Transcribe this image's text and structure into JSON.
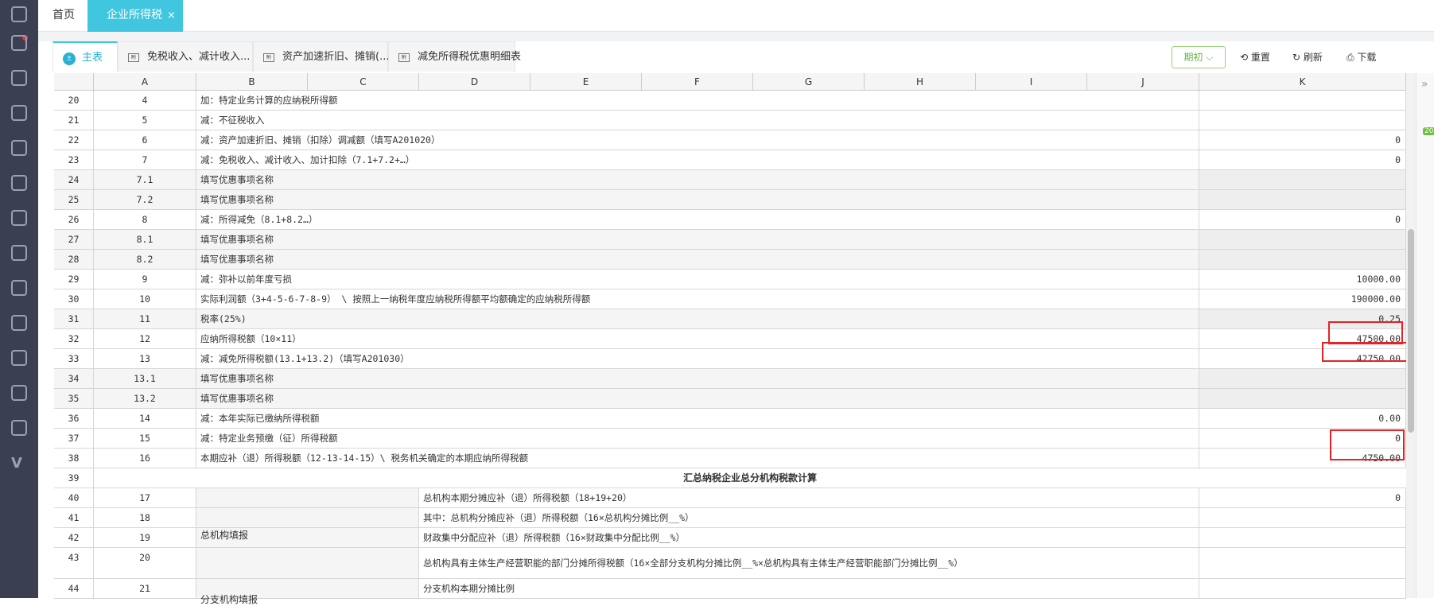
{
  "tabs": {
    "home": "首页",
    "active": "企业所得税",
    "close": "×"
  },
  "sheet_tabs": [
    {
      "label": "主表",
      "icon": "主"
    },
    {
      "label": "免税收入、减计收入...",
      "icon": "附"
    },
    {
      "label": "资产加速折旧、摊销(...",
      "icon": "附"
    },
    {
      "label": "减免所得税优惠明细表",
      "icon": "附"
    }
  ],
  "toolbar": {
    "period": "期初 ⌵",
    "reset": "重置",
    "refresh": "刷新",
    "download": "下载"
  },
  "columns": [
    "A",
    "B",
    "C",
    "D",
    "E",
    "F",
    "G",
    "H",
    "I",
    "J",
    "K"
  ],
  "rows": [
    {
      "n": "20",
      "idx": "4",
      "desc": "加：特定业务计算的应纳税所得额",
      "val": "",
      "shaded": false
    },
    {
      "n": "21",
      "idx": "5",
      "desc": "减：不征税收入",
      "val": "",
      "shaded": false
    },
    {
      "n": "22",
      "idx": "6",
      "desc": "减：资产加速折旧、摊销（扣除）调减额（填写A201020）",
      "val": "0",
      "shaded": false
    },
    {
      "n": "23",
      "idx": "7",
      "desc": "减：免税收入、减计收入、加计扣除（7.1+7.2+…）",
      "val": "0",
      "shaded": false
    },
    {
      "n": "24",
      "idx": "7.1",
      "desc": "填写优惠事项名称",
      "val": "",
      "shaded": true
    },
    {
      "n": "25",
      "idx": "7.2",
      "desc": "填写优惠事项名称",
      "val": "",
      "shaded": true
    },
    {
      "n": "26",
      "idx": "8",
      "desc": "减：所得减免（8.1+8.2…）",
      "val": "0",
      "shaded": false
    },
    {
      "n": "27",
      "idx": "8.1",
      "desc": "填写优惠事项名称",
      "val": "",
      "shaded": true
    },
    {
      "n": "28",
      "idx": "8.2",
      "desc": "填写优惠事项名称",
      "val": "",
      "shaded": true
    },
    {
      "n": "29",
      "idx": "9",
      "desc": "减：弥补以前年度亏损",
      "val": "10000.00",
      "shaded": false
    },
    {
      "n": "30",
      "idx": "10",
      "desc": "实际利润额（3+4-5-6-7-8-9） \\ 按照上一纳税年度应纳税所得额平均额确定的应纳税所得额",
      "val": "190000.00",
      "shaded": false
    },
    {
      "n": "31",
      "idx": "11",
      "desc": "税率(25%)",
      "val": "0.25",
      "shaded": true
    },
    {
      "n": "32",
      "idx": "12",
      "desc": "应纳所得税额（10×11）",
      "val": "47500.00",
      "shaded": false
    },
    {
      "n": "33",
      "idx": "13",
      "desc": "减：减免所得税额(13.1+13.2)（填写A201030）",
      "val": "42750.00",
      "shaded": false
    },
    {
      "n": "34",
      "idx": "13.1",
      "desc": "填写优惠事项名称",
      "val": "",
      "shaded": true
    },
    {
      "n": "35",
      "idx": "13.2",
      "desc": "填写优惠事项名称",
      "val": "",
      "shaded": true
    },
    {
      "n": "36",
      "idx": "14",
      "desc": "减：本年实际已缴纳所得税额",
      "val": "0.00",
      "shaded": false
    },
    {
      "n": "37",
      "idx": "15",
      "desc": "减：特定业务预缴（征）所得税额",
      "val": "0",
      "shaded": false
    },
    {
      "n": "38",
      "idx": "16",
      "desc": "本期应补（退）所得税额（12-13-14-15）\\ 税务机关确定的本期应纳所得税额",
      "val": "4750.00",
      "shaded": false
    }
  ],
  "section_row": {
    "n": "39",
    "title": "汇总纳税企业总分机构税款计算"
  },
  "lower_rows": [
    {
      "n": "40",
      "idx": "17",
      "desc": "总机构本期分摊应补（退）所得税额（18+19+20）",
      "val": "0"
    },
    {
      "n": "41",
      "idx": "18",
      "desc": "其中：总机构分摊应补（退）所得税额（16×总机构分摊比例__%）",
      "val": ""
    },
    {
      "n": "42",
      "idx": "19",
      "desc": "财政集中分配应补（退）所得税额（16×财政集中分配比例__%）",
      "val": ""
    },
    {
      "n": "43",
      "idx": "20",
      "desc": "总机构具有主体生产经营职能的部门分摊所得税额（16×全部分支机构分摊比例__%×总机构具有主体生产经营职能部门分摊比例__%）",
      "val": ""
    },
    {
      "n": "44",
      "idx": "21",
      "desc": "分支机构本期分摊比例",
      "val": ""
    }
  ],
  "group_labels": {
    "hq": "总机构填报",
    "branch": "分支机构填报"
  },
  "edge_badge": "20"
}
